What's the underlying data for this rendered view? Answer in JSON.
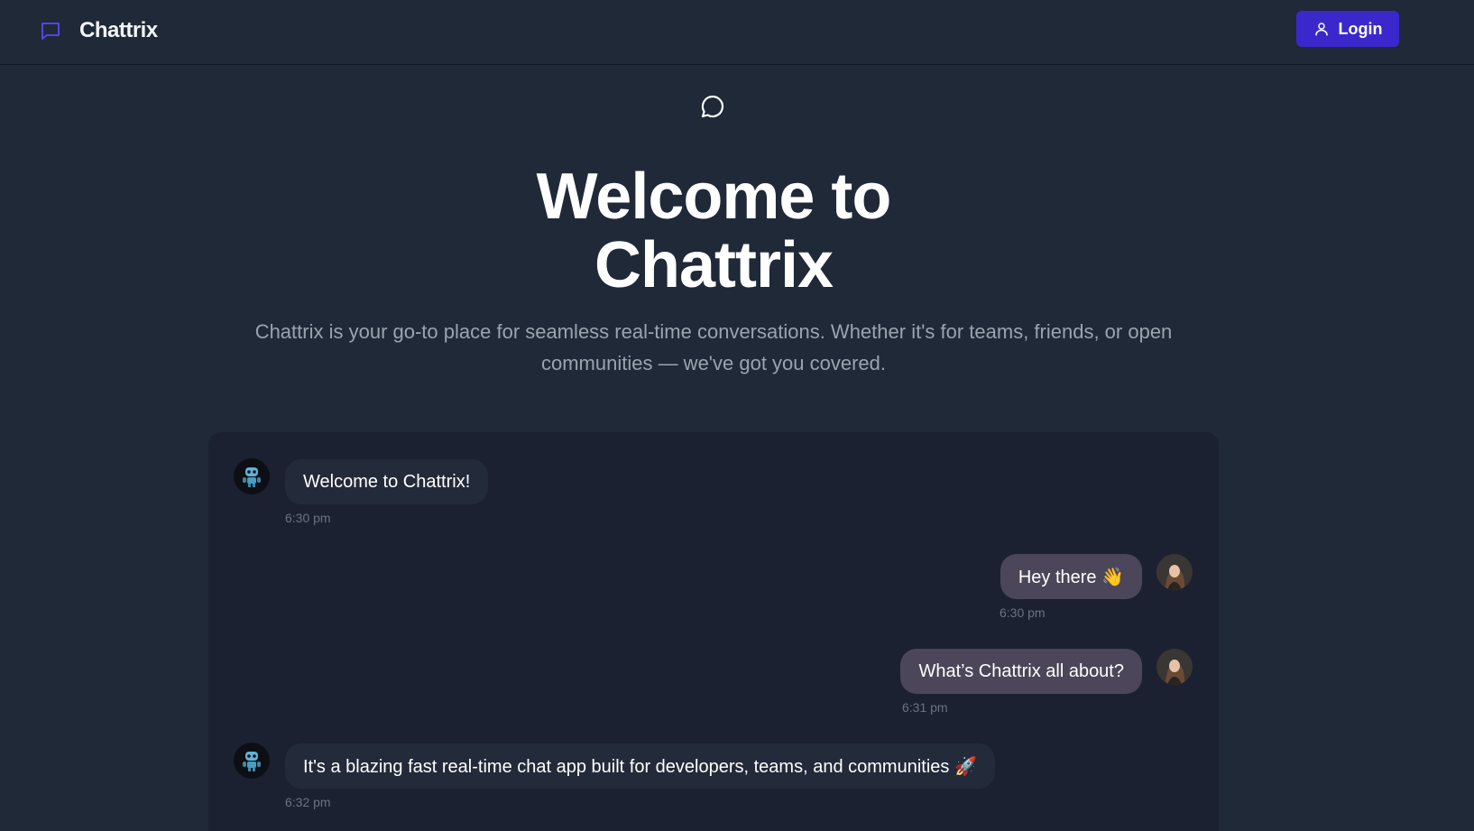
{
  "app": {
    "brand": "Chattrix",
    "accent": "#3b28cc"
  },
  "header": {
    "login_label": "Login"
  },
  "hero": {
    "title_line1": "Welcome to",
    "title_line2": "Chattrix",
    "subtitle_line1": "Chattrix is your go-to place for seamless real-time conversations. Whether it's for teams, friends, or open",
    "subtitle_line2": "communities — we've got you covered."
  },
  "chat": {
    "messages": [
      {
        "sender": "bot",
        "text": "Welcome to Chattrix!",
        "time": "6:30 pm"
      },
      {
        "sender": "user",
        "text": "Hey there 👋",
        "time": "6:30 pm"
      },
      {
        "sender": "user",
        "text": "What’s Chattrix all about?",
        "time": "6:31 pm"
      },
      {
        "sender": "bot",
        "text": "It's a blazing fast real-time chat app built for developers, teams, and communities 🚀",
        "time": "6:32 pm"
      }
    ]
  }
}
